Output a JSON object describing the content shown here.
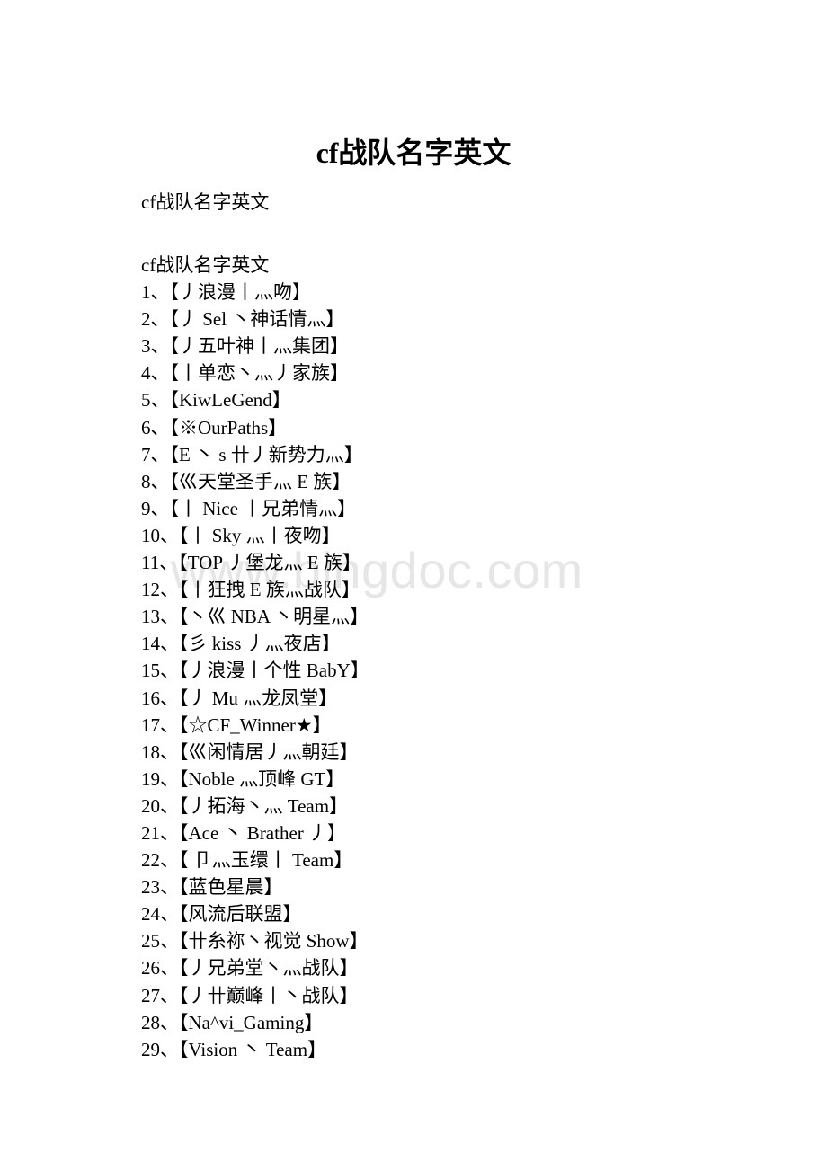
{
  "document": {
    "title": "cf战队名字英文",
    "subtitle": "cf战队名字英文",
    "list_heading": "cf战队名字英文",
    "items": [
      {
        "num": "1、",
        "name": "【丿浪漫丨灬吻】"
      },
      {
        "num": "2、",
        "name": "【丿 Sel 丶神话情灬】"
      },
      {
        "num": "3、",
        "name": "【丿五叶神丨灬集团】"
      },
      {
        "num": "4、",
        "name": "【丨单恋丶灬丿家族】"
      },
      {
        "num": "5、",
        "name": "【KiwLeGend】"
      },
      {
        "num": "6、",
        "name": "【※OurPaths】"
      },
      {
        "num": "7、",
        "name": "【E 丶 s 卄丿新势力灬】"
      },
      {
        "num": "8、",
        "name": "【巛天堂圣手灬 E 族】"
      },
      {
        "num": "9、",
        "name": "【丨 Nice 丨兄弟情灬】"
      },
      {
        "num": "10、",
        "name": "【丨 Sky 灬丨夜吻】"
      },
      {
        "num": "11、",
        "name": "【TOP 丿堡龙灬 E 族】"
      },
      {
        "num": "12、",
        "name": "【丨狂拽 E 族灬战队】"
      },
      {
        "num": "13、",
        "name": "【丶巛 NBA 丶明星灬】"
      },
      {
        "num": "14、",
        "name": "【彡 kiss 丿灬夜店】"
      },
      {
        "num": "15、",
        "name": "【丿浪漫丨个性 BabY】"
      },
      {
        "num": "16、",
        "name": "【丿 Mu 灬龙凤堂】"
      },
      {
        "num": "17、",
        "name": "【☆CF_Winner★】"
      },
      {
        "num": "18、",
        "name": "【巛闲情居丿灬朝廷】"
      },
      {
        "num": "19、",
        "name": "【Noble 灬顶峰 GT】"
      },
      {
        "num": "20、",
        "name": "【丿拓海丶灬 Team】"
      },
      {
        "num": "21、",
        "name": "【Ace 丶 Brather 丿】"
      },
      {
        "num": "22、",
        "name": "【 卩灬玉缳丨 Team】"
      },
      {
        "num": "23、",
        "name": "【蓝色星晨】"
      },
      {
        "num": "24、",
        "name": "【风流后联盟】"
      },
      {
        "num": "25、",
        "name": "【卄糸祢丶视觉 Show】"
      },
      {
        "num": "26、",
        "name": "【丿兄弟堂丶灬战队】"
      },
      {
        "num": "27、",
        "name": "【丿卄巅峰丨丶战队】"
      },
      {
        "num": "28、",
        "name": "【Na^vi_Gaming】"
      },
      {
        "num": "29、",
        "name": "【Vision 丶 Team】"
      }
    ]
  },
  "watermark": "www.bingdoc.com"
}
